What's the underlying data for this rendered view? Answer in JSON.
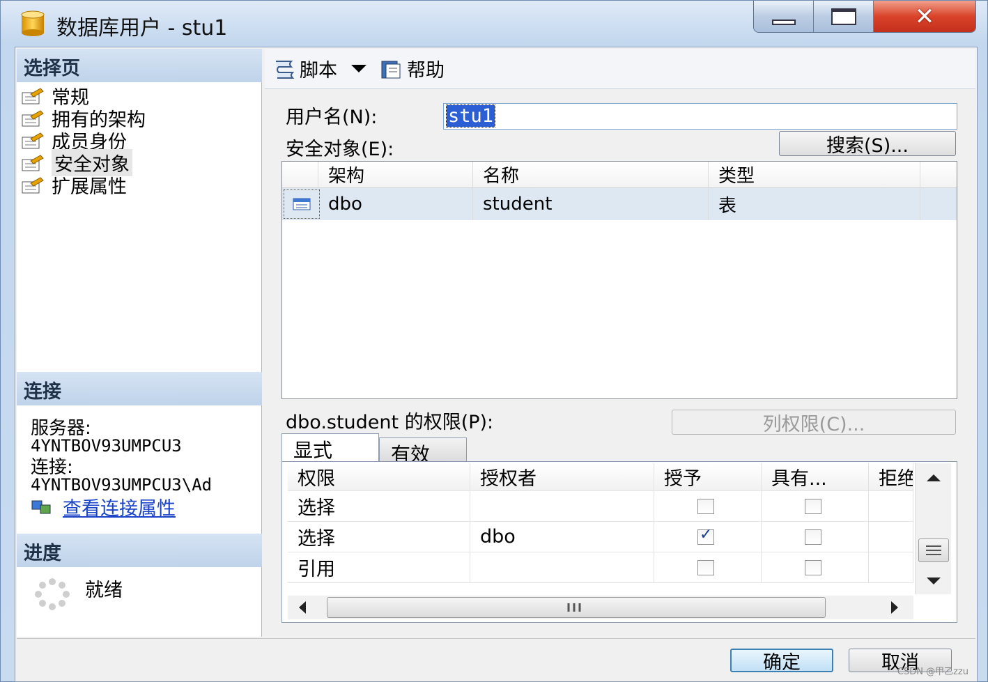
{
  "window": {
    "title": "数据库用户 - stu1",
    "controls": {
      "minimize": "minimize",
      "maximize": "maximize",
      "close": "✕"
    }
  },
  "left": {
    "select_page_header": "选择页",
    "nav": [
      {
        "label": "常规"
      },
      {
        "label": "拥有的架构"
      },
      {
        "label": "成员身份"
      },
      {
        "label": "安全对象",
        "selected": true
      },
      {
        "label": "扩展属性"
      }
    ],
    "connection_header": "连接",
    "server_label": "服务器:",
    "server_value": "4YNTBOV93UMPCU3",
    "connection_label": "连接:",
    "connection_value": "4YNTBOV93UMPCU3\\Ad",
    "view_connection_link": "查看连接属性",
    "progress_header": "进度",
    "progress_status": "就绪"
  },
  "toolbar": {
    "script_label": "脚本",
    "help_label": "帮助"
  },
  "form": {
    "username_label": "用户名(N):",
    "username_value": "stu1",
    "securables_label": "安全对象(E):",
    "search_button": "搜索(S)..."
  },
  "securables_grid": {
    "columns": [
      "架构",
      "名称",
      "类型"
    ],
    "rows": [
      {
        "schema": "dbo",
        "name": "student",
        "type": "表"
      }
    ]
  },
  "permissions": {
    "label": "dbo.student 的权限(P):",
    "column_permissions_button": "列权限(C)...",
    "tabs": [
      "显式",
      "有效"
    ],
    "columns": [
      "权限",
      "授权者",
      "授予",
      "具有...",
      "拒绝"
    ],
    "rows": [
      {
        "permission": "选择",
        "grantor": "",
        "grant": false,
        "with_grant": false
      },
      {
        "permission": "选择",
        "grantor": "dbo",
        "grant": true,
        "with_grant": false
      },
      {
        "permission": "引用",
        "grantor": "",
        "grant": false,
        "with_grant": false
      }
    ]
  },
  "footer": {
    "ok_button": "确定",
    "cancel_button": "取消"
  },
  "watermark": "CSDN @甲乙zzu"
}
